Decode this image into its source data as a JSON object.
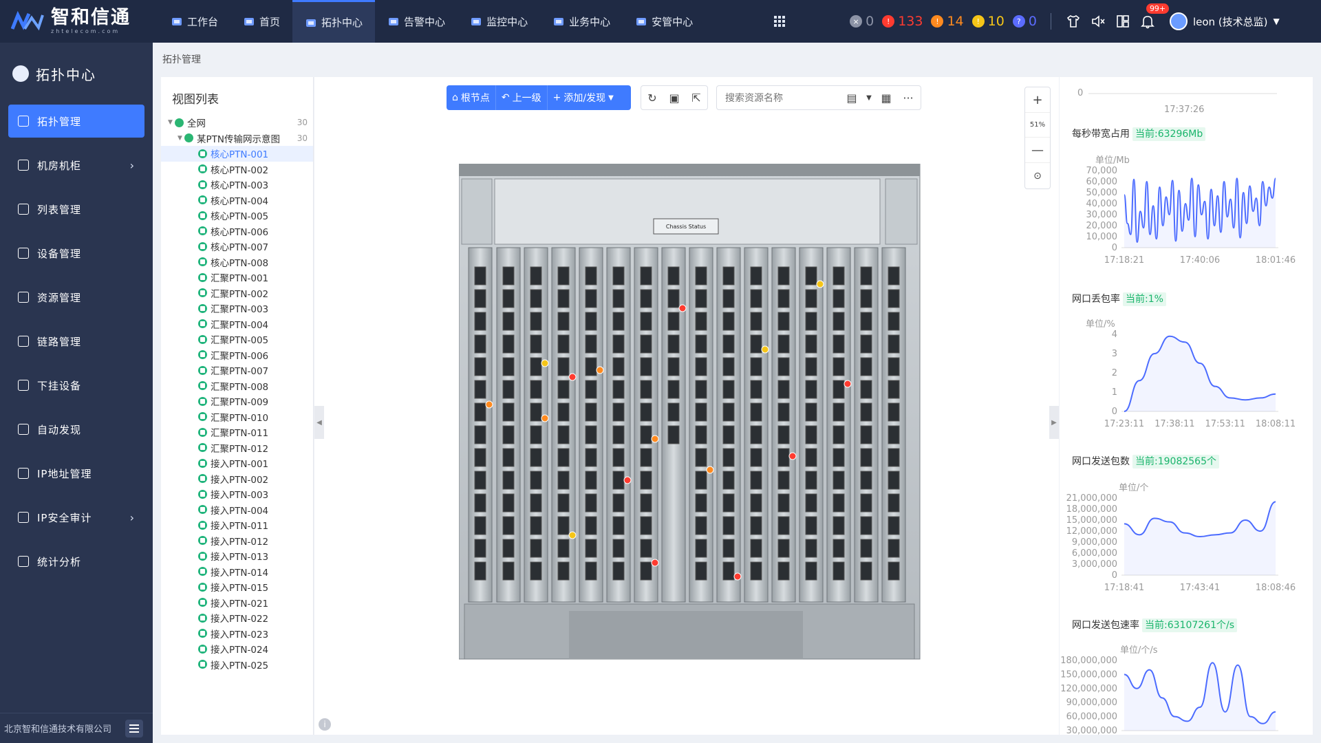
{
  "logo": {
    "cn": "智和信通",
    "en": "zhtelecom.com"
  },
  "nav": [
    {
      "label": "工作台",
      "icon": "home-icon"
    },
    {
      "label": "首页",
      "icon": "house-icon"
    },
    {
      "label": "拓扑中心",
      "icon": "compass-icon",
      "active": true
    },
    {
      "label": "告警中心",
      "icon": "warning-icon"
    },
    {
      "label": "监控中心",
      "icon": "chart-icon"
    },
    {
      "label": "业务中心",
      "icon": "briefcase-icon"
    },
    {
      "label": "安管中心",
      "icon": "shield-icon"
    }
  ],
  "alarms": [
    {
      "count": "0",
      "color": "#8c93a6",
      "glyph": "×"
    },
    {
      "count": "133",
      "color": "#ff3b30",
      "glyph": "!"
    },
    {
      "count": "14",
      "color": "#ff8a1f",
      "glyph": "!"
    },
    {
      "count": "10",
      "color": "#f5c518",
      "glyph": "!"
    },
    {
      "count": "0",
      "color": "#5b6cff",
      "glyph": "?"
    }
  ],
  "notify_badge": "99+",
  "user": {
    "name": "leon (技术总监)"
  },
  "sidebar": {
    "title": "拓扑中心",
    "items": [
      {
        "label": "拓扑管理",
        "active": true,
        "arrow": false
      },
      {
        "label": "机房机柜",
        "active": false,
        "arrow": true
      },
      {
        "label": "列表管理",
        "active": false,
        "arrow": false
      },
      {
        "label": "设备管理",
        "active": false,
        "arrow": false
      },
      {
        "label": "资源管理",
        "active": false,
        "arrow": false
      },
      {
        "label": "链路管理",
        "active": false,
        "arrow": false
      },
      {
        "label": "下挂设备",
        "active": false,
        "arrow": false
      },
      {
        "label": "自动发现",
        "active": false,
        "arrow": false
      },
      {
        "label": "IP地址管理",
        "active": false,
        "arrow": false
      },
      {
        "label": "IP安全审计",
        "active": false,
        "arrow": true
      },
      {
        "label": "统计分析",
        "active": false,
        "arrow": false
      }
    ],
    "footer": "北京智和信通技术有限公司"
  },
  "breadcrumb": "拓扑管理",
  "tree": {
    "title": "视图列表",
    "root": {
      "label": "全网",
      "count": "30"
    },
    "group": {
      "label": "某PTN传输网示意图",
      "count": "30"
    },
    "leaves": [
      "核心PTN-001",
      "核心PTN-002",
      "核心PTN-003",
      "核心PTN-004",
      "核心PTN-005",
      "核心PTN-006",
      "核心PTN-007",
      "核心PTN-008",
      "汇聚PTN-001",
      "汇聚PTN-002",
      "汇聚PTN-003",
      "汇聚PTN-004",
      "汇聚PTN-005",
      "汇聚PTN-006",
      "汇聚PTN-007",
      "汇聚PTN-008",
      "汇聚PTN-009",
      "汇聚PTN-010",
      "汇聚PTN-011",
      "汇聚PTN-012",
      "接入PTN-001",
      "接入PTN-002",
      "接入PTN-003",
      "接入PTN-004",
      "接入PTN-011",
      "接入PTN-012",
      "接入PTN-013",
      "接入PTN-014",
      "接入PTN-015",
      "接入PTN-021",
      "接入PTN-022",
      "接入PTN-023",
      "接入PTN-024",
      "接入PTN-025"
    ],
    "selected_index": 0
  },
  "toolbar": {
    "root_label": "根节点",
    "up_label": "上一级",
    "add_label": "添加/发现",
    "search_placeholder": "搜索资源名称"
  },
  "zoom": {
    "level": "51%"
  },
  "chassis": {
    "status_label": "Chassis Status"
  },
  "metrics": {
    "top_axis": {
      "value": "0",
      "time": "17:37:26"
    },
    "bandwidth": {
      "label": "每秒带宽占用",
      "current": "当前:63296Mb",
      "unit": "单位/Mb"
    },
    "loss": {
      "label": "网口丢包率",
      "current": "当前:1%",
      "unit": "单位/%"
    },
    "sent": {
      "label": "网口发送包数",
      "current": "当前:19082565个",
      "unit": "单位/个"
    },
    "rate": {
      "label": "网口发送包速率",
      "current": "当前:63107261个/s",
      "unit": "单位/个/s"
    }
  },
  "chart_data": [
    {
      "type": "line",
      "title": "每秒带宽占用",
      "ylabel": "单位/Mb",
      "ylim": [
        0,
        70000
      ],
      "yticks": [
        "70,000",
        "60,000",
        "50,000",
        "40,000",
        "30,000",
        "20,000",
        "10,000",
        "0"
      ],
      "xticks": [
        "17:18:21",
        "17:40:06",
        "18:01:46"
      ],
      "values": [
        48000,
        22000,
        12000,
        62000,
        5000,
        33000,
        18000,
        60000,
        12000,
        38000,
        8000,
        55000,
        20000,
        46000,
        30000,
        61000,
        6000,
        52000,
        15000,
        40000,
        25000,
        63000,
        10000,
        57000,
        30000,
        42000,
        8000,
        53000,
        20000,
        47000,
        14000,
        60000,
        28000,
        44000,
        18000,
        63000,
        9000,
        50000,
        22000,
        56000,
        33000,
        45000,
        20000,
        60000,
        38000,
        55000,
        45000,
        63000
      ],
      "area": true
    },
    {
      "type": "line",
      "title": "网口丢包率",
      "ylabel": "单位/%",
      "ylim": [
        0,
        4
      ],
      "yticks": [
        "4",
        "3",
        "2",
        "1",
        "0"
      ],
      "xticks": [
        "17:23:11",
        "17:38:11",
        "17:53:11",
        "18:08:11"
      ],
      "values": [
        0,
        1.6,
        3.0,
        3.9,
        3.6,
        2.5,
        1.3,
        0.7,
        0.6,
        0.7,
        0.9
      ],
      "area": true
    },
    {
      "type": "line",
      "title": "网口发送包数",
      "ylabel": "单位/个",
      "ylim": [
        0,
        21000000
      ],
      "yticks": [
        "21,000,000",
        "18,000,000",
        "15,000,000",
        "12,000,000",
        "9,000,000",
        "6,000,000",
        "3,000,000",
        "0"
      ],
      "xticks": [
        "17:18:41",
        "17:43:41",
        "18:08:46"
      ],
      "values": [
        14000000,
        11000000,
        15500000,
        14500000,
        11500000,
        10500000,
        11000000,
        11500000,
        15000000,
        12000000,
        20000000
      ],
      "area": true
    },
    {
      "type": "line",
      "title": "网口发送包速率",
      "ylabel": "单位/个/s",
      "ylim": [
        30000000,
        180000000
      ],
      "yticks": [
        "180,000,000",
        "150,000,000",
        "120,000,000",
        "90,000,000",
        "60,000,000",
        "30,000,000"
      ],
      "xticks": [],
      "values": [
        150000000,
        120000000,
        160000000,
        100000000,
        60000000,
        50000000,
        80000000,
        175000000,
        70000000,
        170000000,
        60000000,
        45000000,
        70000000
      ],
      "area": true
    }
  ]
}
